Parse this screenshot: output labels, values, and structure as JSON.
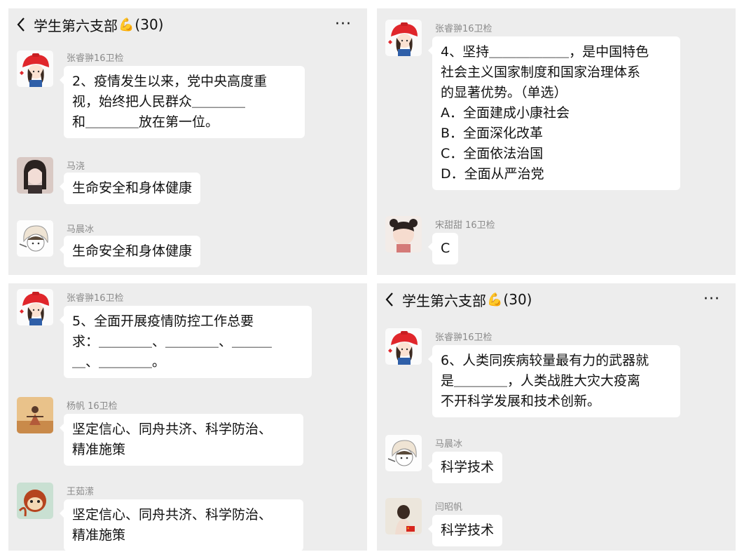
{
  "panel1": {
    "header": {
      "back_icon": "chevron-left-icon",
      "title": "学生第六支部",
      "emoji": "💪",
      "count": "(30)",
      "more_icon": "more-dots-icon",
      "more_glyph": "···"
    },
    "messages": [
      {
        "name": "张睿翀16卫检",
        "avatar": "red-helmet-girl-avatar",
        "lines": [
          "2、疫情发生以来，党中央高度重",
          "视，始终把人民群众＿＿＿＿",
          "和＿＿＿＿放在第一位。"
        ]
      },
      {
        "name": "马浇",
        "avatar": "girl-photo-avatar",
        "lines": [
          "生命安全和身体健康"
        ]
      },
      {
        "name": "马晨冰",
        "avatar": "cartoon-girl-avatar",
        "lines": [
          "生命安全和身体健康"
        ]
      }
    ]
  },
  "panel2": {
    "messages": [
      {
        "name": "张睿翀16卫检",
        "avatar": "red-helmet-girl-avatar",
        "lines": [
          "4、坚持＿＿＿＿＿＿，是中国特色",
          "社会主义国家制度和国家治理体系",
          "的显著优势。（单选）"
        ],
        "options": [
          "A．全面建成小康社会",
          "B．全面深化改革",
          "C．全面依法治国",
          "D．全面从严治党"
        ]
      },
      {
        "name": "宋甜甜 16卫检",
        "avatar": "cute-girl-avatar",
        "lines": [
          "C"
        ]
      }
    ]
  },
  "panel3": {
    "messages": [
      {
        "name": "张睿翀16卫检",
        "avatar": "red-helmet-girl-avatar",
        "lines": [
          "5、全面开展疫情防控工作总要",
          "求：＿＿＿＿、＿＿＿＿、＿＿＿",
          "＿、＿＿＿＿。"
        ]
      },
      {
        "name": "杨帆 16卫检",
        "avatar": "desert-photo-avatar",
        "lines": [
          "坚定信心、同舟共济、科学防治、",
          "精准施策"
        ]
      },
      {
        "name": "王茹潆",
        "avatar": "cartoon-monkey-avatar",
        "lines": [
          "坚定信心、同舟共济、科学防治、",
          "精准施策"
        ]
      }
    ]
  },
  "panel4": {
    "header": {
      "back_icon": "chevron-left-icon",
      "title": "学生第六支部",
      "emoji": "💪",
      "count": "(30)",
      "more_icon": "more-dots-icon",
      "more_glyph": "···"
    },
    "messages": [
      {
        "name": "张睿翀16卫检",
        "avatar": "red-helmet-girl-avatar",
        "lines": [
          "6、人类同疾病较量最有力的武器就",
          "是＿＿＿＿，人类战胜大灾大疫离",
          "不开科学发展和技术创新。"
        ]
      },
      {
        "name": "马晨冰",
        "avatar": "cartoon-girl-avatar",
        "lines": [
          "科学技术"
        ]
      },
      {
        "name": "闫昭帆",
        "avatar": "back-view-girl-avatar",
        "lines": [
          "科学技术"
        ]
      }
    ]
  }
}
